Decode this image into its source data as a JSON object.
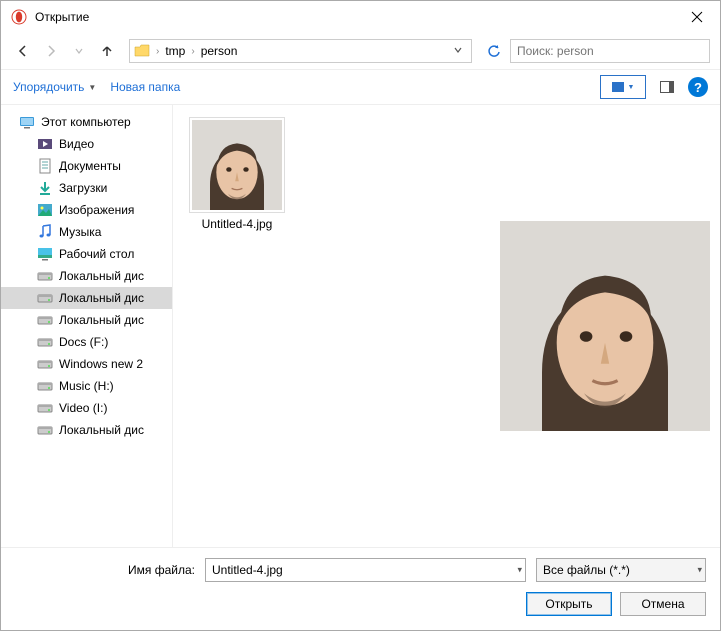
{
  "title": "Открытие",
  "breadcrumb": {
    "parts": [
      "tmp",
      "person"
    ]
  },
  "search": {
    "placeholder": "Поиск: person"
  },
  "toolbar": {
    "organize": "Упорядочить",
    "newfolder": "Новая папка"
  },
  "tree": {
    "items": [
      {
        "label": "Этот компьютер",
        "icon": "pc",
        "indent": false
      },
      {
        "label": "Видео",
        "icon": "video",
        "indent": true
      },
      {
        "label": "Документы",
        "icon": "docs",
        "indent": true
      },
      {
        "label": "Загрузки",
        "icon": "down",
        "indent": true
      },
      {
        "label": "Изображения",
        "icon": "img",
        "indent": true
      },
      {
        "label": "Музыка",
        "icon": "music",
        "indent": true
      },
      {
        "label": "Рабочий стол",
        "icon": "desk",
        "indent": true
      },
      {
        "label": "Локальный дис",
        "icon": "drive",
        "indent": true
      },
      {
        "label": "Локальный дис",
        "icon": "drive",
        "indent": true,
        "selected": true
      },
      {
        "label": "Локальный дис",
        "icon": "drive",
        "indent": true
      },
      {
        "label": "Docs (F:)",
        "icon": "drive",
        "indent": true
      },
      {
        "label": "Windows new 2",
        "icon": "drive",
        "indent": true
      },
      {
        "label": "Music (H:)",
        "icon": "drive",
        "indent": true
      },
      {
        "label": "Video (I:)",
        "icon": "drive",
        "indent": true
      },
      {
        "label": "Локальный дис",
        "icon": "drive",
        "indent": true
      }
    ]
  },
  "file": {
    "name": "Untitled-4.jpg"
  },
  "footer": {
    "filename_label": "Имя файла:",
    "filename_value": "Untitled-4.jpg",
    "filter": "Все файлы (*.*)",
    "open": "Открыть",
    "cancel": "Отмена"
  }
}
